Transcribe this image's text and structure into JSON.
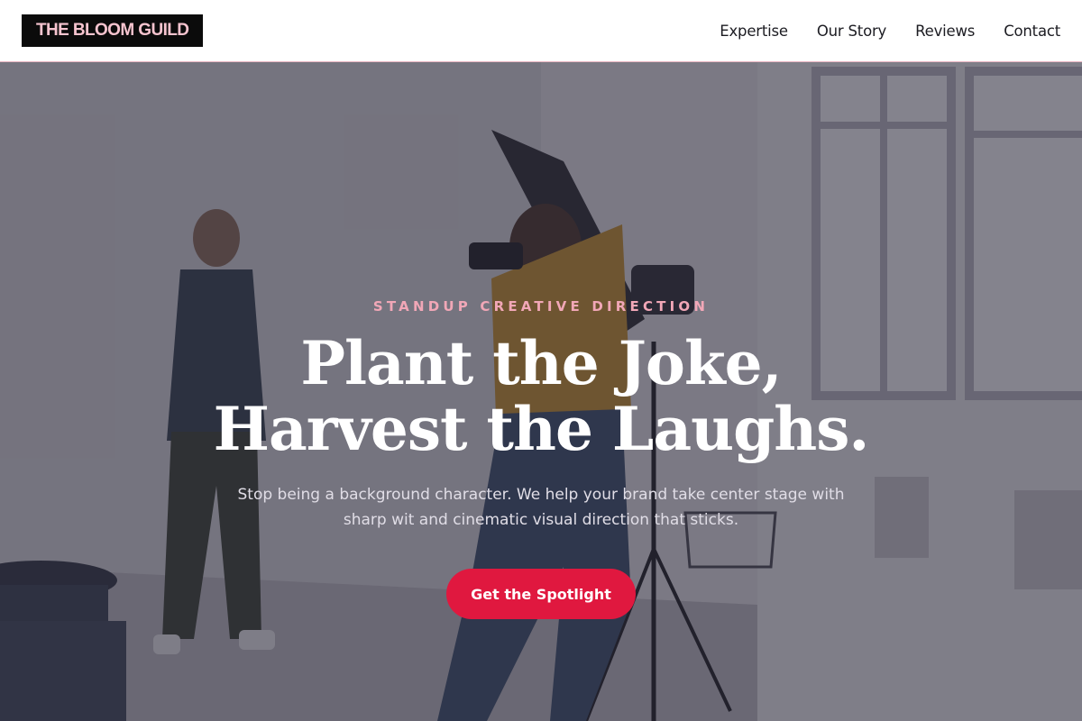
{
  "brand": {
    "name": "THE BLOOM GUILD"
  },
  "nav": {
    "items": [
      {
        "label": "Expertise"
      },
      {
        "label": "Our Story"
      },
      {
        "label": "Reviews"
      },
      {
        "label": "Contact"
      }
    ]
  },
  "hero": {
    "eyebrow": "STANDUP CREATIVE DIRECTION",
    "headline_line1": "Plant the Joke,",
    "headline_line2": "Harvest the Laughs.",
    "subhead": "Stop being a background character. We help your brand take center stage with sharp wit and cinematic visual direction that sticks.",
    "cta_label": "Get the Spotlight",
    "background": "photo-studio-photographer-and-model"
  },
  "colors": {
    "accent": "#e0183f",
    "eyebrow": "#f1a7b7",
    "logo_bg": "#0b0b0b",
    "logo_text": "#f6c4cf",
    "header_border": "#e8b4c0"
  }
}
